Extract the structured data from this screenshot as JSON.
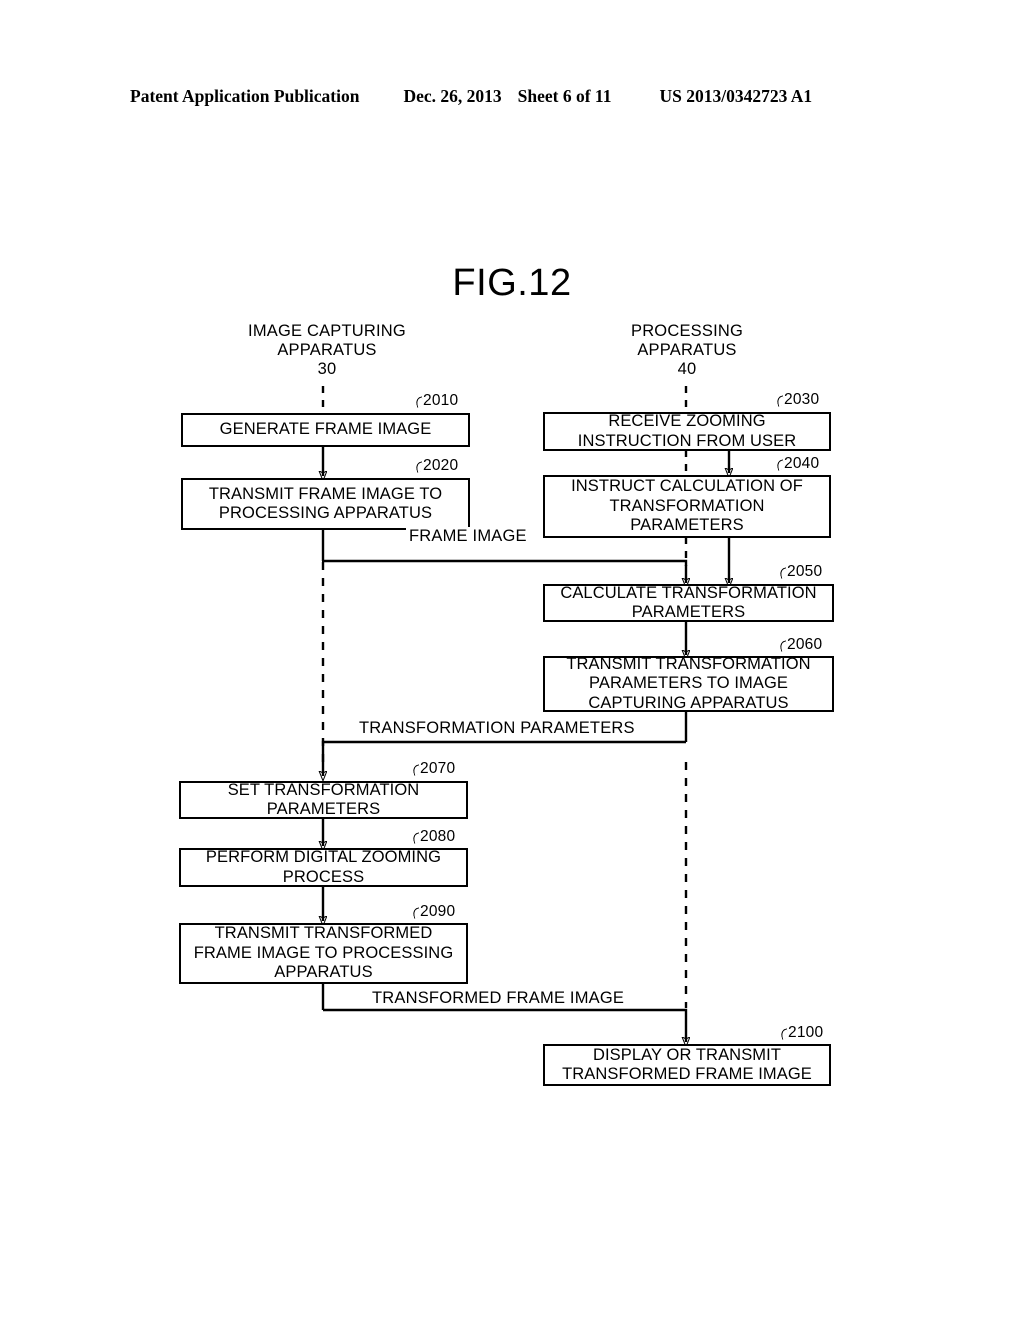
{
  "header": {
    "publication": "Patent Application Publication",
    "date": "Dec. 26, 2013",
    "sheet": "Sheet 6 of 11",
    "patent_number": "US 2013/0342723 A1"
  },
  "figure": {
    "title": "FIG.12"
  },
  "lanes": [
    {
      "id": "image-capturing-apparatus",
      "label": "IMAGE CAPTURING\nAPPARATUS\n30"
    },
    {
      "id": "processing-apparatus",
      "label": "PROCESSING\nAPPARATUS\n40"
    }
  ],
  "steps": [
    {
      "ref": "2010",
      "lane": "left",
      "text": "GENERATE FRAME IMAGE"
    },
    {
      "ref": "2020",
      "lane": "left",
      "text": "TRANSMIT FRAME IMAGE TO\nPROCESSING APPARATUS"
    },
    {
      "ref": "2030",
      "lane": "right",
      "text": "RECEIVE ZOOMING\nINSTRUCTION FROM USER"
    },
    {
      "ref": "2040",
      "lane": "right",
      "text": "INSTRUCT CALCULATION OF\nTRANSFORMATION\nPARAMETERS"
    },
    {
      "ref": "2050",
      "lane": "right",
      "text": "CALCULATE TRANSFORMATION\nPARAMETERS"
    },
    {
      "ref": "2060",
      "lane": "right",
      "text": "TRANSMIT TRANSFORMATION\nPARAMETERS TO IMAGE\nCAPTURING APPARATUS"
    },
    {
      "ref": "2070",
      "lane": "left",
      "text": "SET TRANSFORMATION\nPARAMETERS"
    },
    {
      "ref": "2080",
      "lane": "left",
      "text": "PERFORM DIGITAL ZOOMING\nPROCESS"
    },
    {
      "ref": "2090",
      "lane": "left",
      "text": "TRANSMIT TRANSFORMED\nFRAME IMAGE TO PROCESSING\nAPPARATUS"
    },
    {
      "ref": "2100",
      "lane": "right",
      "text": "DISPLAY OR TRANSMIT\nTRANSFORMED FRAME IMAGE"
    }
  ],
  "messages": [
    {
      "id": "frame-image",
      "label": "FRAME IMAGE",
      "from": "2020",
      "to": "2050"
    },
    {
      "id": "transformation-parameters",
      "label": "TRANSFORMATION PARAMETERS",
      "from": "2060",
      "to": "2070"
    },
    {
      "id": "transformed-frame-image",
      "label": "TRANSFORMED FRAME IMAGE",
      "from": "2090",
      "to": "2100"
    }
  ],
  "refs": {
    "r2010": "2010",
    "r2020": "2020",
    "r2030": "2030",
    "r2040": "2040",
    "r2050": "2050",
    "r2060": "2060",
    "r2070": "2070",
    "r2080": "2080",
    "r2090": "2090",
    "r2100": "2100"
  },
  "colors": {
    "ink": "#000000",
    "paper": "#ffffff"
  }
}
